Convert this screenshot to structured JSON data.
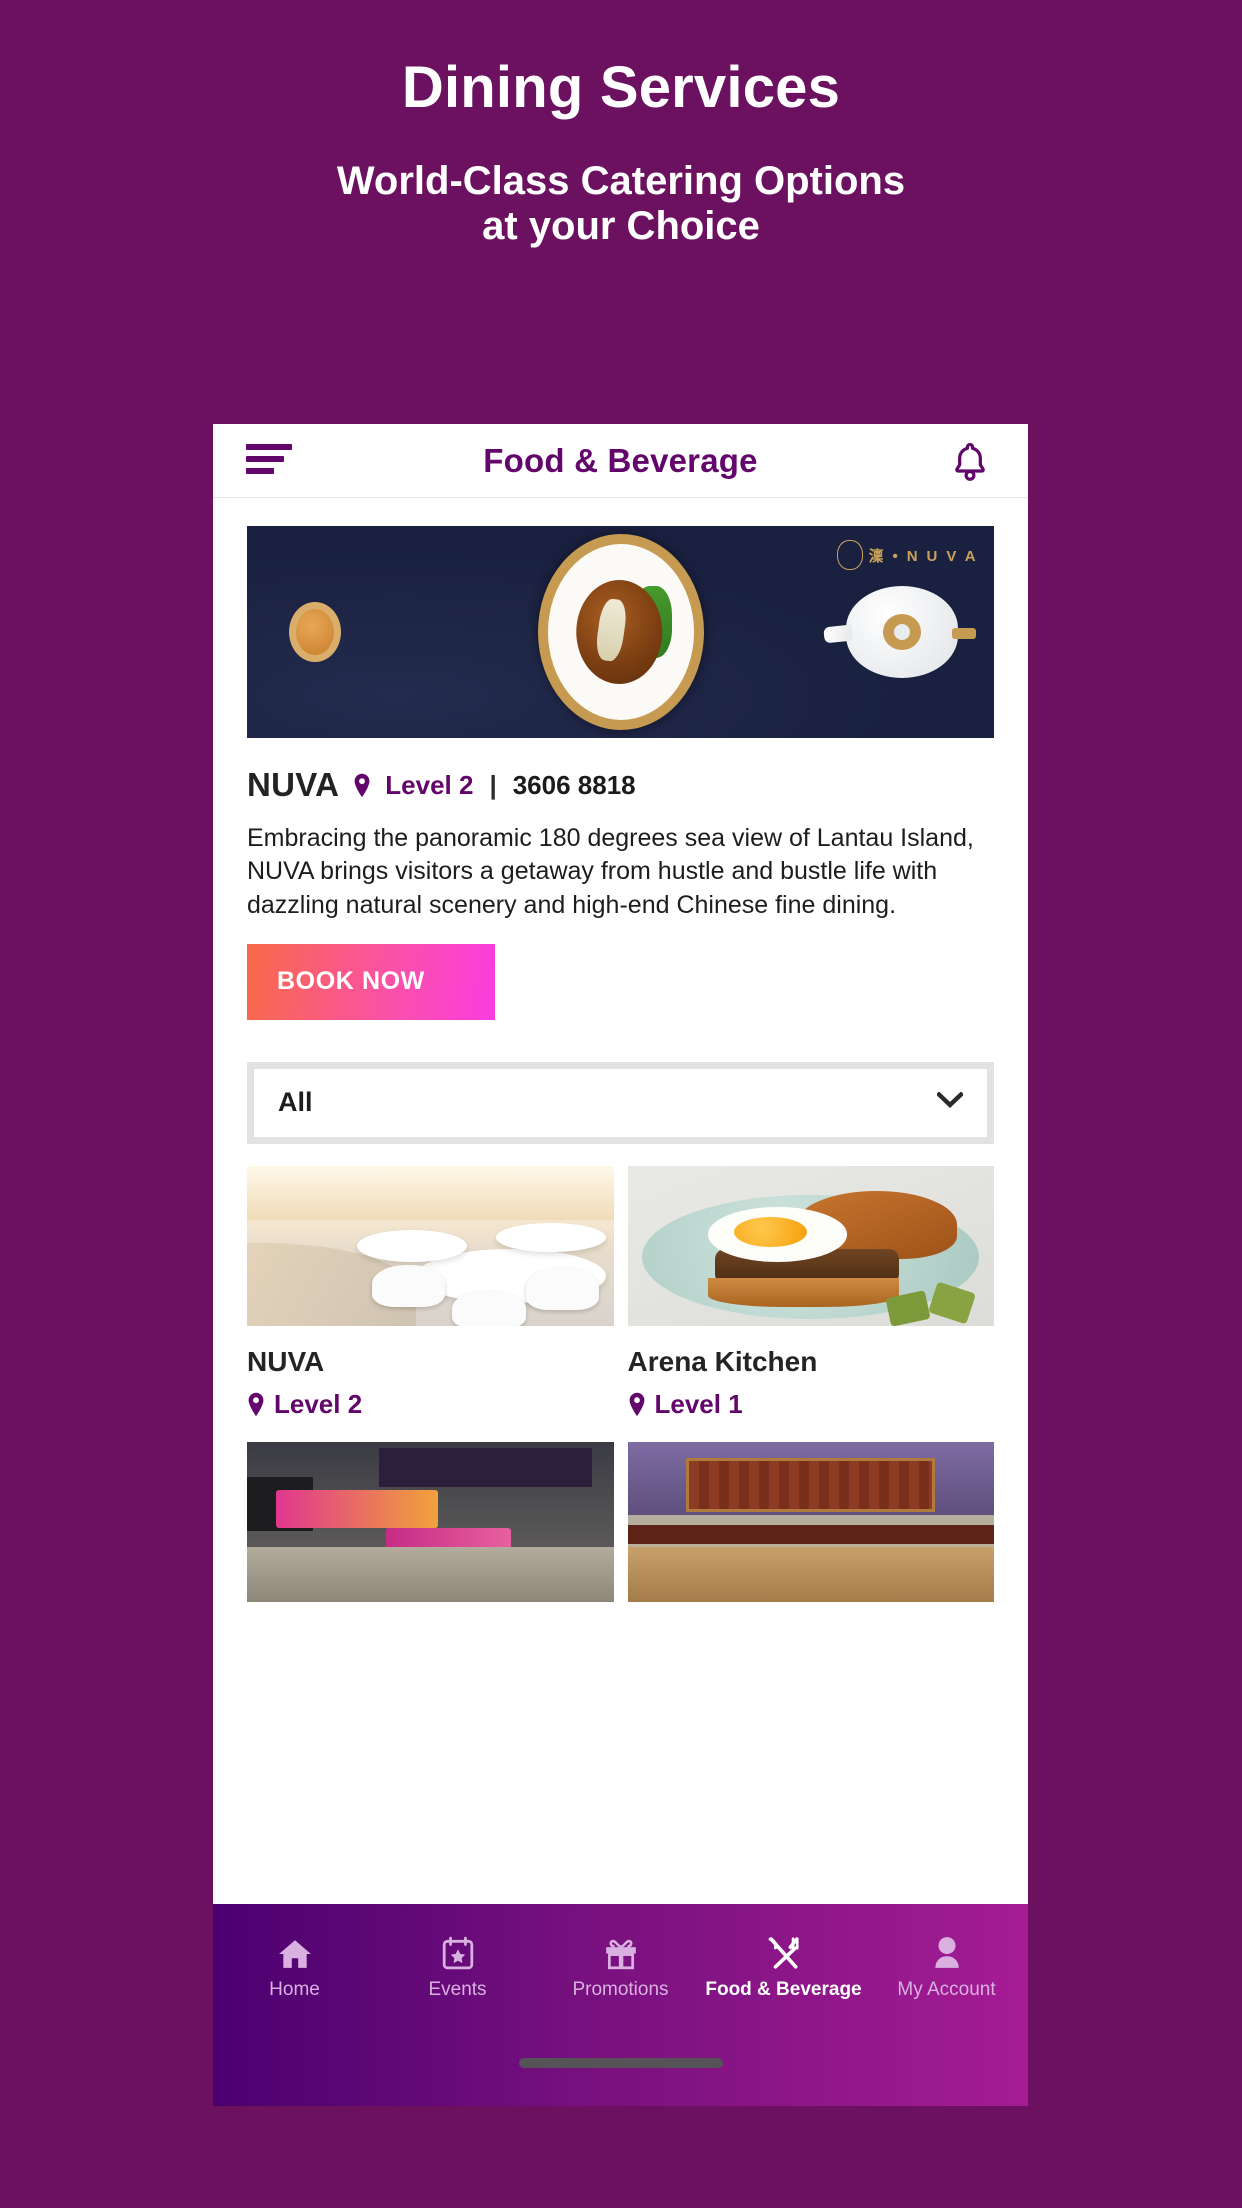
{
  "promo": {
    "title": "Dining Services",
    "subtitle": "World-Class Catering Options\nat your Choice"
  },
  "theme": {
    "page_background": "#6B1160",
    "brand_purple": "#63066B",
    "nav_gradient_start": "#4B0070",
    "nav_gradient_end": "#A51C94",
    "book_button_gradient_start": "#F96A47",
    "book_button_gradient_end": "#F93DE0"
  },
  "appbar": {
    "menu_icon": "hamburger-icon",
    "title": "Food & Beverage",
    "notification_icon": "bell-icon"
  },
  "hero": {
    "logo_text": "澟 • N U V A",
    "alt": "NUVA signature noodles on gold-rimmed plate with tea cup and teapot"
  },
  "featured": {
    "name": "NUVA",
    "location_icon": "location-pin-icon",
    "level": "Level 2",
    "separator": "|",
    "phone": "3606 8818",
    "description": "Embracing the panoramic 180 degrees sea view of Lantau Island, NUVA brings visitors a getaway from hustle and bustle life with dazzling natural scenery and high-end Chinese fine dining.",
    "book_button_label": "BOOK NOW"
  },
  "filter": {
    "selected": "All",
    "chevron_icon": "chevron-down-icon",
    "options": [
      "All"
    ]
  },
  "restaurants": [
    {
      "name": "NUVA",
      "level": "Level 2",
      "location_icon": "location-pin-icon",
      "art": "art-dining"
    },
    {
      "name": "Arena Kitchen",
      "level": "Level 1",
      "location_icon": "location-pin-icon",
      "art": "art-burger"
    },
    {
      "name": "",
      "level": "",
      "location_icon": "location-pin-icon",
      "art": "art-shop"
    },
    {
      "name": "",
      "level": "",
      "location_icon": "location-pin-icon",
      "art": "art-cafe"
    }
  ],
  "bottom_nav": {
    "items": [
      {
        "label": "Home",
        "icon": "home-icon",
        "active": false
      },
      {
        "label": "Events",
        "icon": "calendar-star-icon",
        "active": false
      },
      {
        "label": "Promotions",
        "icon": "gift-icon",
        "active": false
      },
      {
        "label": "Food & Beverage",
        "icon": "fork-knife-icon",
        "active": true
      },
      {
        "label": "My Account",
        "icon": "person-icon",
        "active": false
      }
    ]
  },
  "system": {
    "home_indicator": "home-indicator-bar"
  }
}
